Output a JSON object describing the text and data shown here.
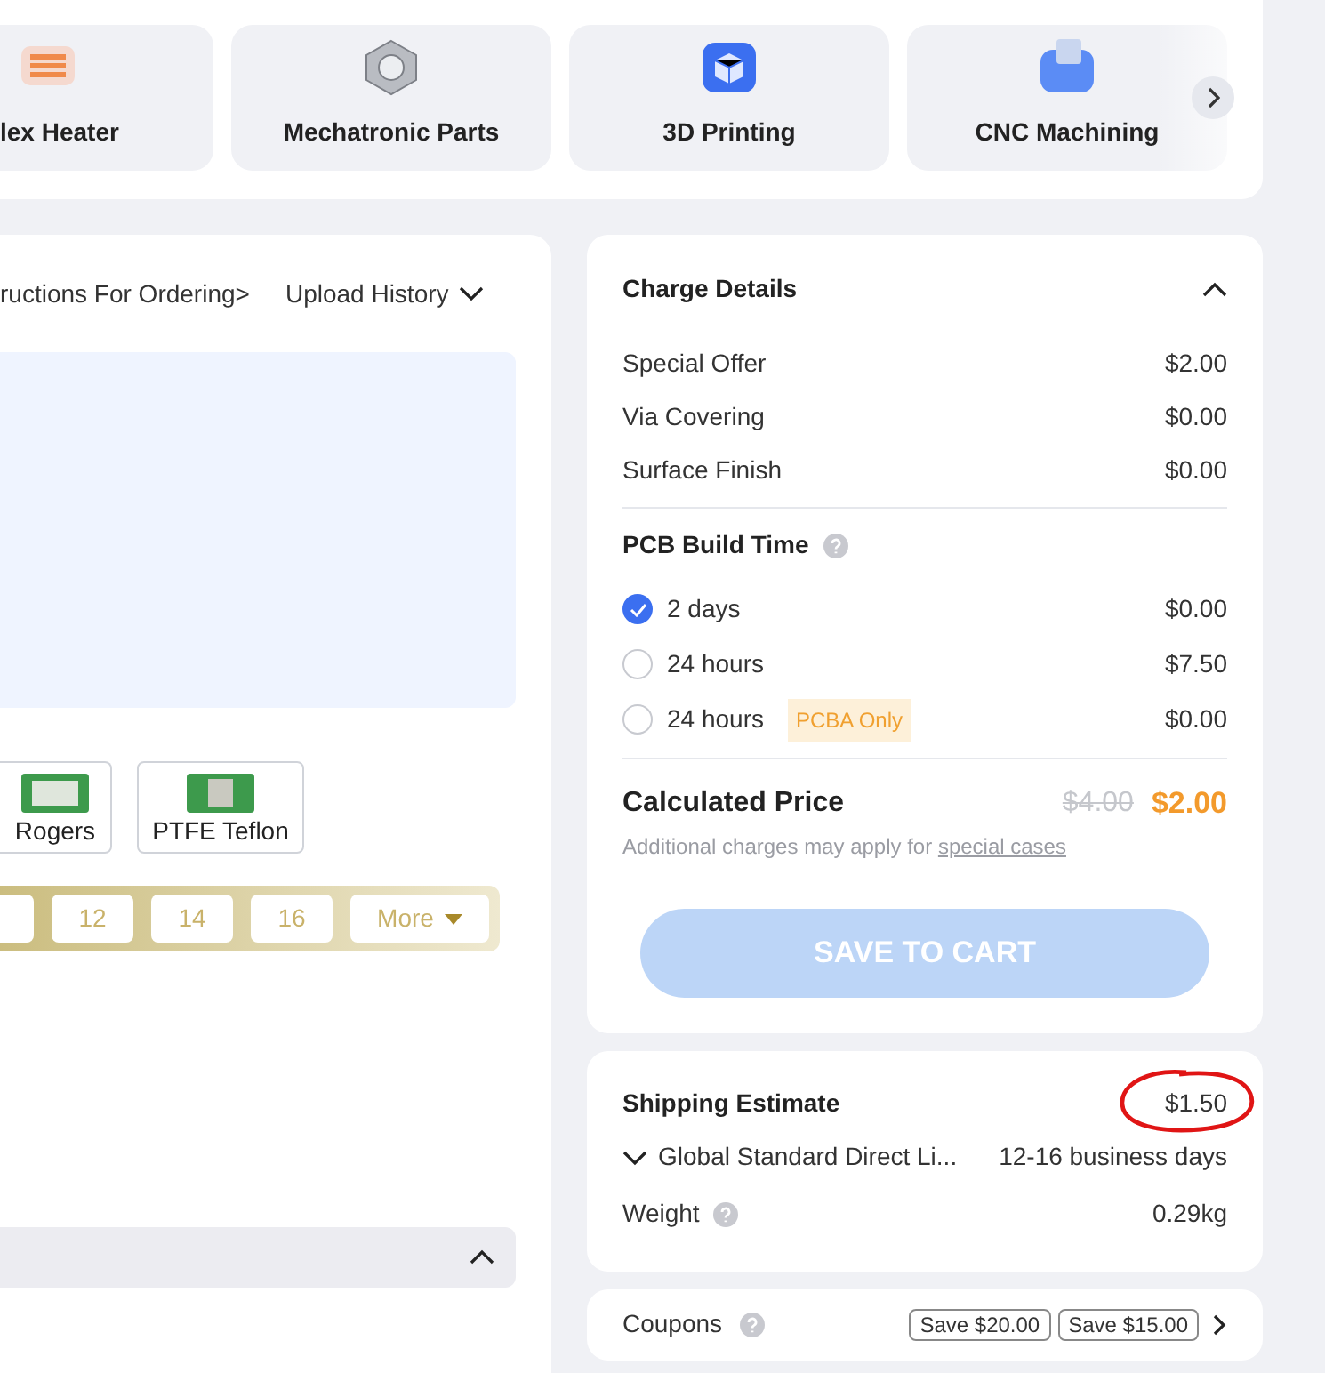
{
  "categories": [
    {
      "label": "lex Heater",
      "kind": "heater"
    },
    {
      "label": "Mechatronic Parts",
      "kind": "nut"
    },
    {
      "label": "3D Printing",
      "kind": "print3d"
    },
    {
      "label": "CNC Machining",
      "kind": "cnc"
    }
  ],
  "order_links": {
    "instructions": "ructions For Ordering>",
    "upload_history": "Upload History"
  },
  "materials": [
    {
      "label": "Rogers",
      "kind": "rogers"
    },
    {
      "label": "PTFE Teflon",
      "kind": "ptfe"
    }
  ],
  "thickness_options": [
    "12",
    "14",
    "16"
  ],
  "more_button": "More",
  "bottom_section": {
    "expanded": true
  },
  "charge_details": {
    "title": "Charge Details",
    "expanded": true,
    "items": [
      {
        "label": "Special Offer",
        "value": "$2.00"
      },
      {
        "label": "Via Covering",
        "value": "$0.00"
      },
      {
        "label": "Surface Finish",
        "value": "$0.00"
      }
    ],
    "build_time": {
      "title": "PCB Build Time",
      "options": [
        {
          "label": "2 days",
          "price": "$0.00",
          "selected": true
        },
        {
          "label": "24 hours",
          "price": "$7.50",
          "selected": false
        },
        {
          "label": "24 hours",
          "tag": "PCBA Only",
          "price": "$0.00",
          "selected": false
        }
      ]
    },
    "calculated_price": {
      "label": "Calculated Price",
      "original": "$4.00",
      "price": "$2.00",
      "note": "Additional charges may apply for",
      "link": "special cases"
    },
    "button": {
      "label": "SAVE TO CART",
      "disabled": true
    }
  },
  "shipping": {
    "title": "Shipping Estimate",
    "price": "$1.50",
    "circled": true,
    "method": "Global Standard Direct Li...",
    "delivery": "12-16 business days",
    "weight_label": "Weight",
    "weight": "0.29kg"
  },
  "coupons": {
    "label": "Coupons",
    "tags": [
      "Save $20.00",
      "Save $15.00"
    ]
  }
}
